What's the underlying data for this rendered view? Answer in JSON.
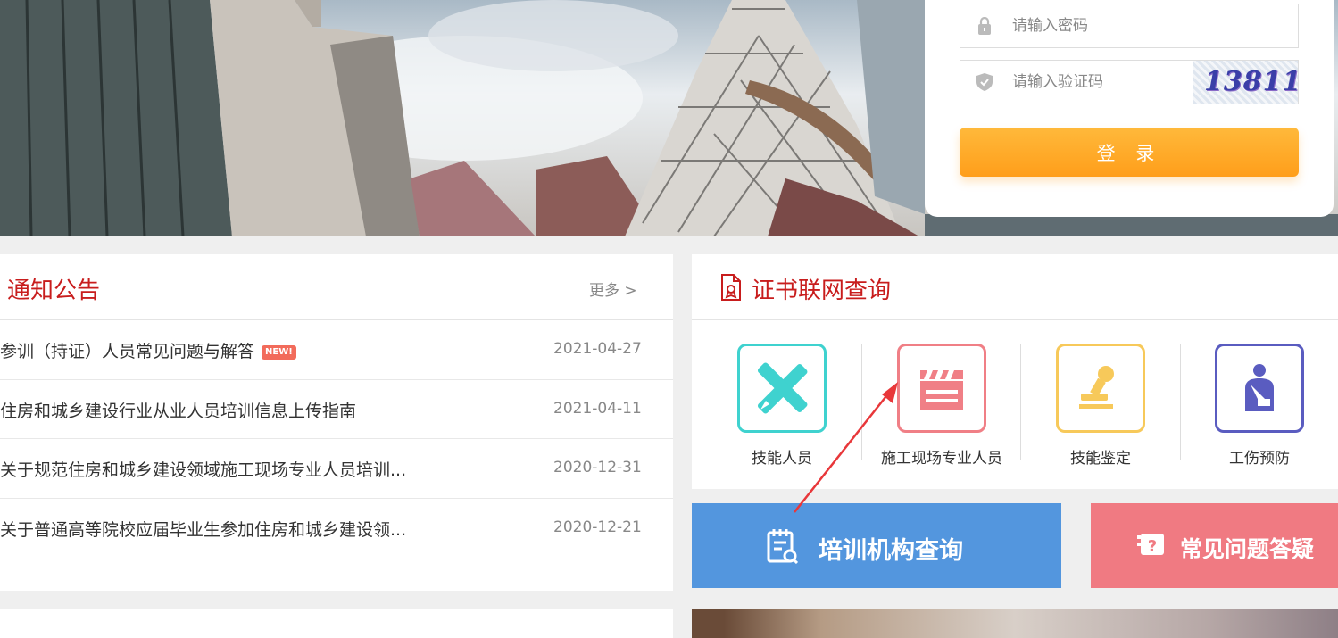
{
  "login": {
    "password_placeholder": "请输入密码",
    "captcha_placeholder": "请输入验证码",
    "captcha_text": "13811",
    "login_button": "登 录"
  },
  "notice": {
    "title": "通知公告",
    "more": "更多 >",
    "new_badge": "NEW!",
    "items": [
      {
        "text": "参训（持证）人员常见问题与解答",
        "date": "2021-04-27"
      },
      {
        "text": "住房和城乡建设行业从业人员培训信息上传指南",
        "date": "2021-04-11"
      },
      {
        "text": "关于规范住房和城乡建设领域施工现场专业人员培训...",
        "date": "2020-12-31"
      },
      {
        "text": "关于普通高等院校应届毕业生参加住房和城乡建设领...",
        "date": "2020-12-21"
      }
    ]
  },
  "cert": {
    "title": "证书联网查询",
    "tiles": [
      {
        "label": "技能人员",
        "icon": "tools-icon",
        "color": "#3fd2cf"
      },
      {
        "label": "施工现场专业人员",
        "icon": "clapperboard-icon",
        "color": "#f07f86"
      },
      {
        "label": "技能鉴定",
        "icon": "stamp-icon",
        "color": "#f7c95a"
      },
      {
        "label": "工伤预防",
        "icon": "injured-worker-icon",
        "color": "#5a5cc0"
      }
    ]
  },
  "actions": {
    "training_query": "培训机构查询",
    "faq": "常见问题答疑"
  },
  "colors": {
    "title_red": "#c81d1d",
    "login_orange": "#ff9e1a",
    "training_blue": "#5396de",
    "faq_pink": "#f07a82"
  }
}
